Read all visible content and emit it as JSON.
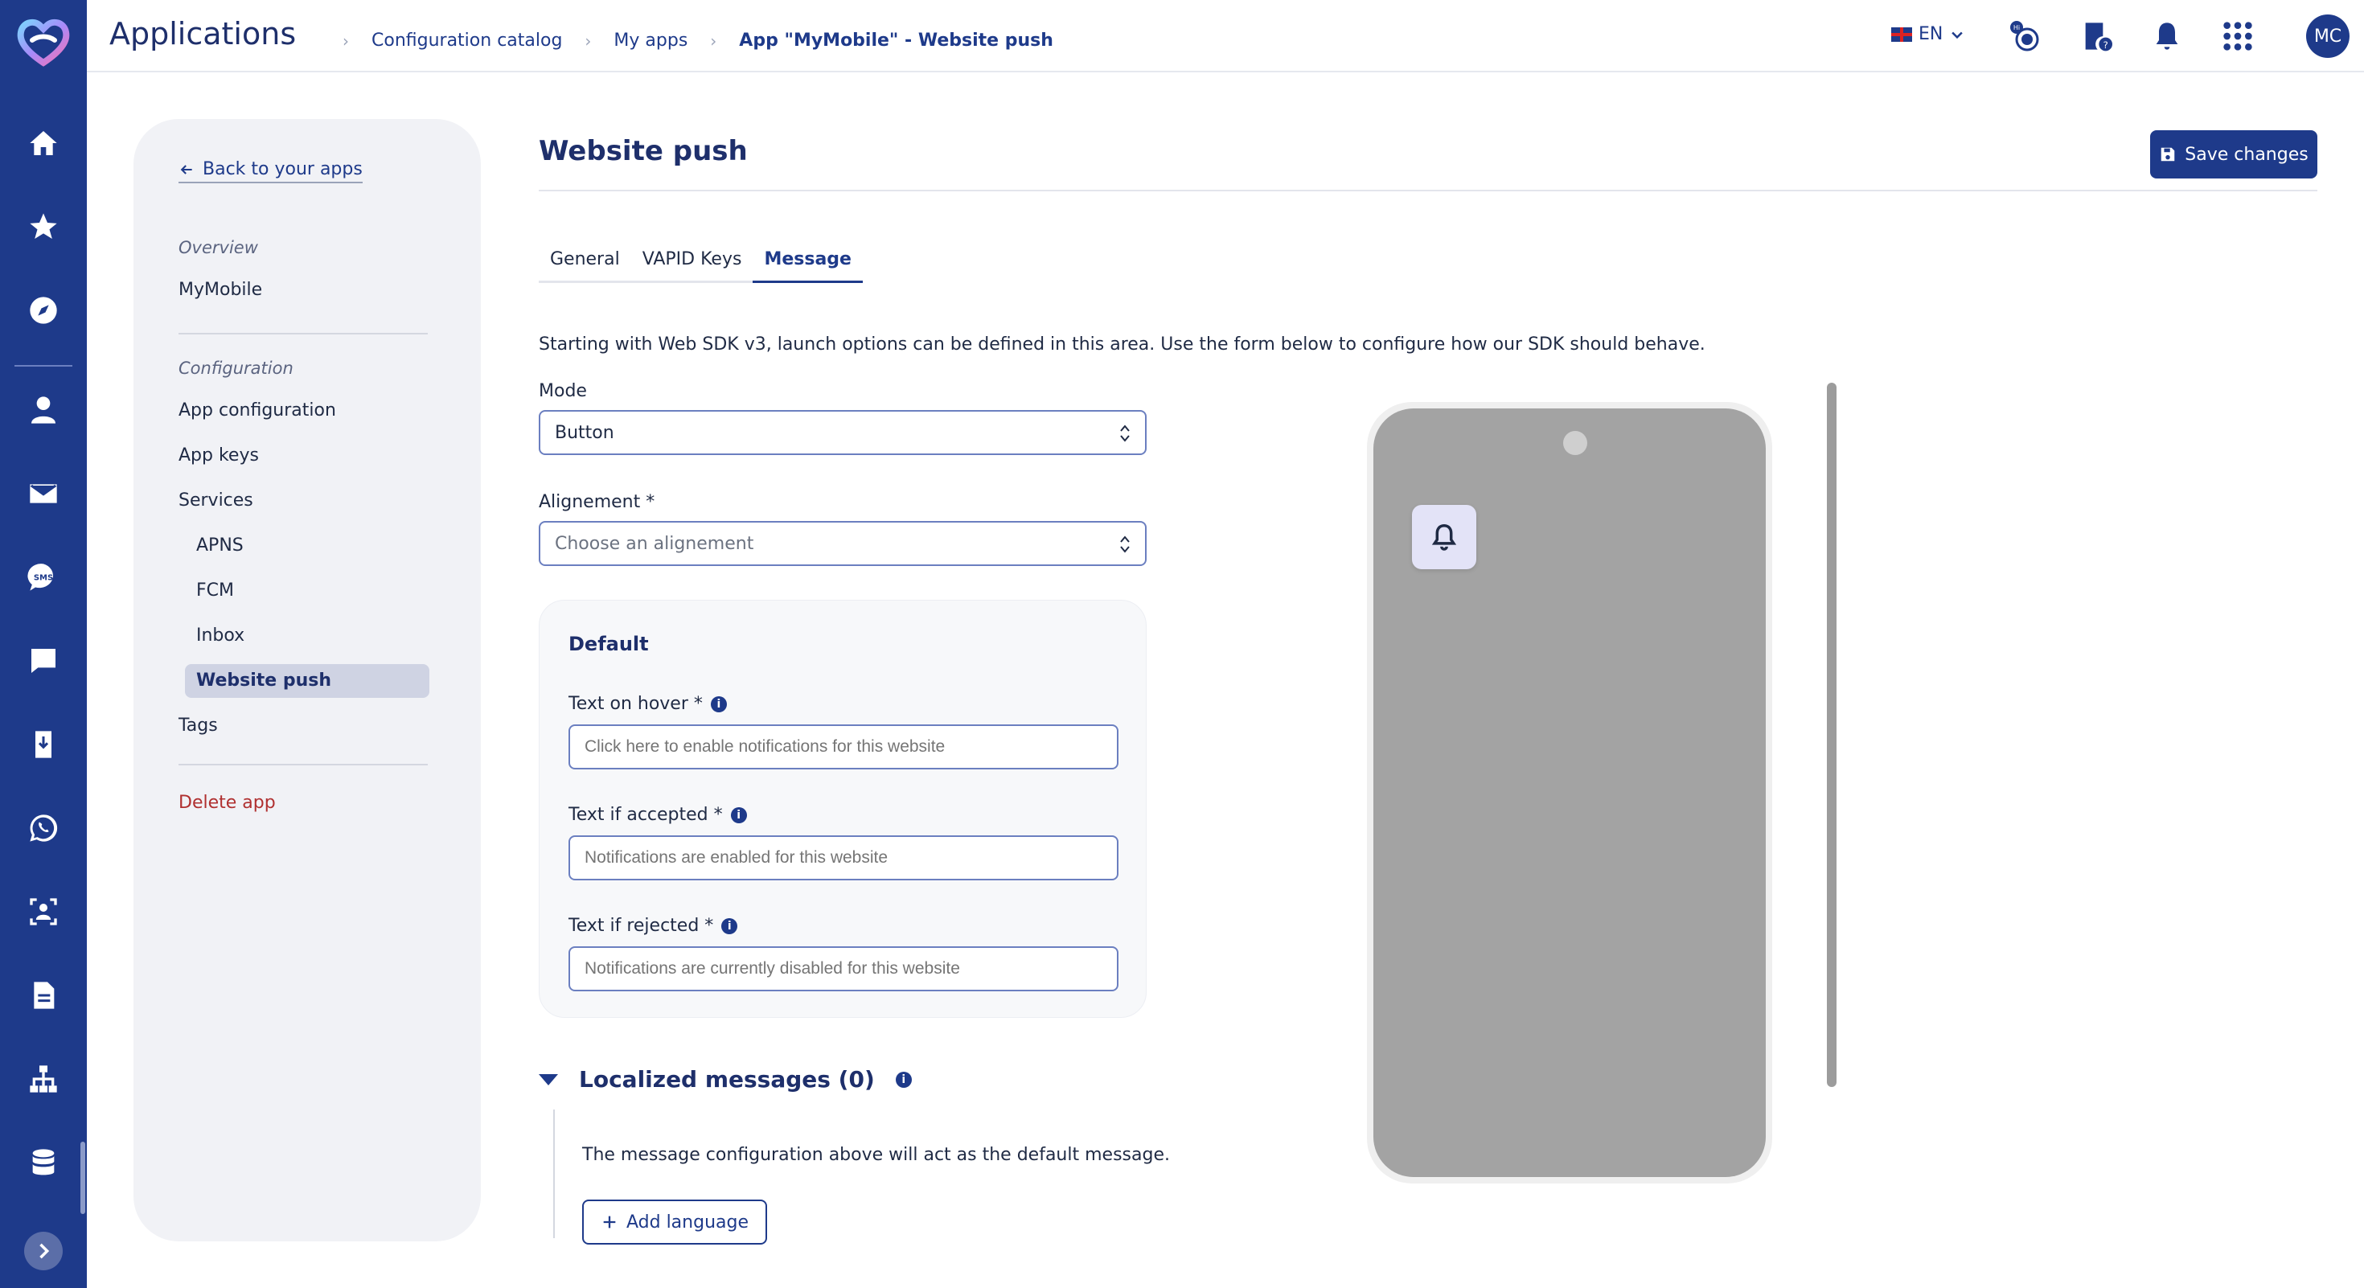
{
  "app": {
    "title": "Applications"
  },
  "breadcrumb": [
    "Configuration catalog",
    "My apps",
    "App \"MyMobile\" - Website push"
  ],
  "topbar": {
    "language": "EN",
    "avatar_initials": "MC",
    "hi_badge": "Hi"
  },
  "subnav": {
    "back_label": "Back to your apps",
    "overview_section": "Overview",
    "app_name": "MyMobile",
    "configuration_section": "Configuration",
    "items": [
      "App configuration",
      "App keys",
      "Services",
      "APNS",
      "FCM",
      "Inbox",
      "Website push",
      "Tags"
    ],
    "active_item": "Website push",
    "delete_label": "Delete app"
  },
  "page": {
    "title": "Website push",
    "save_label": "Save changes"
  },
  "tabs": [
    {
      "label": "General",
      "active": false
    },
    {
      "label": "VAPID Keys",
      "active": false
    },
    {
      "label": "Message",
      "active": true
    }
  ],
  "intro": "Starting with Web SDK v3, launch options can be defined in this area. Use the form below to configure how our SDK should behave.",
  "form": {
    "mode_label": "Mode",
    "mode_value": "Button",
    "alignment_label": "Alignement *",
    "alignment_placeholder": "Choose an alignement",
    "default_title": "Default",
    "hover_label": "Text on hover *",
    "hover_placeholder": "Click here to enable notifications for this website",
    "accepted_label": "Text if accepted *",
    "accepted_placeholder": "Notifications are enabled for this website",
    "rejected_label": "Text if rejected *",
    "rejected_placeholder": "Notifications are currently disabled for this website",
    "info_glyph": "i"
  },
  "localized": {
    "title": "Localized messages (0)",
    "description": "The message configuration above will act as the default message.",
    "add_label": "Add language"
  },
  "colors": {
    "brand": "#1e3a8a",
    "danger": "#b03030",
    "phone_screen": "#a3a3a3"
  }
}
